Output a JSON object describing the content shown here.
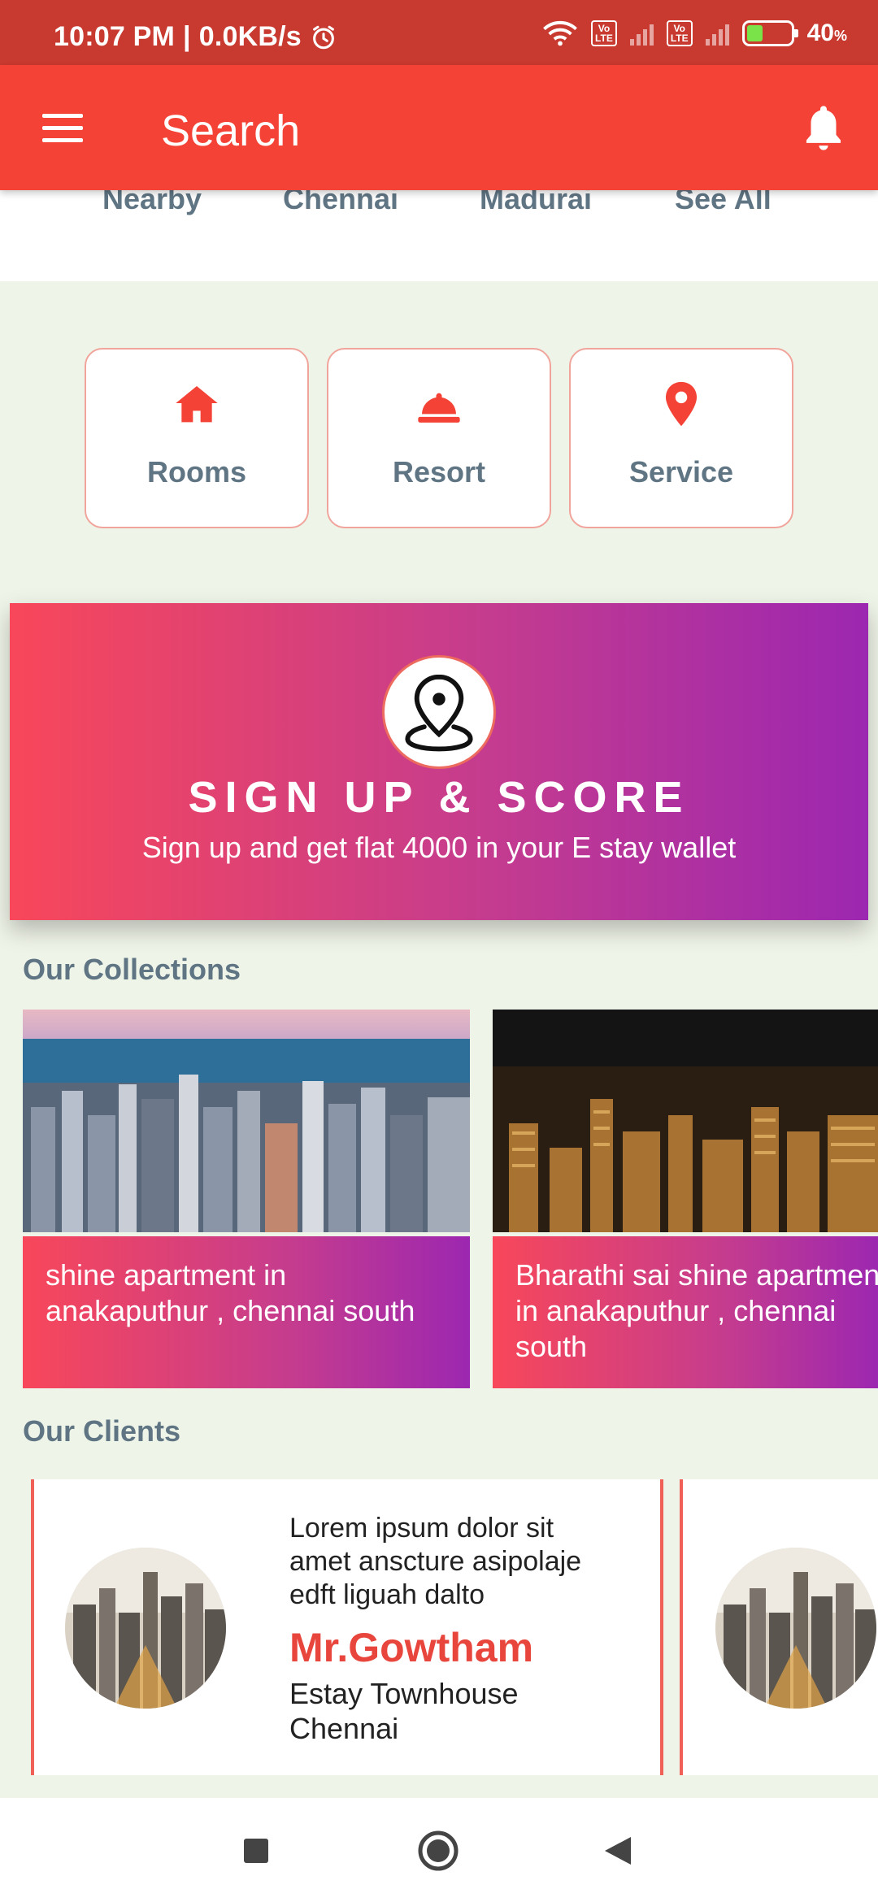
{
  "status_bar": {
    "time": "10:07 PM",
    "net_speed": "0.0KB/s",
    "battery": "40",
    "battery_unit": "%"
  },
  "app_bar": {
    "title": "Search",
    "menu_icon": "menu-icon",
    "notification_icon": "bell-icon"
  },
  "city_tabs": [
    "Nearby",
    "Chennai",
    "Madurai",
    "See All"
  ],
  "categories": [
    {
      "label": "Rooms",
      "icon": "home-icon"
    },
    {
      "label": "Resort",
      "icon": "service-bell-icon"
    },
    {
      "label": "Service",
      "icon": "map-pin-icon"
    }
  ],
  "banner": {
    "title": "SIGN UP & SCORE",
    "subtitle": "Sign up and get flat 4000 in your E stay wallet",
    "icon": "location-pin-icon"
  },
  "collections": {
    "title": "Our Collections",
    "items": [
      {
        "caption_line1": "shine apartment in",
        "caption_line2": "anakaputhur , chennai south",
        "caption_line3": ""
      },
      {
        "caption_line1": "Bharathi sai shine apartment",
        "caption_line2": "in anakaputhur , chennai",
        "caption_line3": "south"
      }
    ]
  },
  "clients": {
    "title": "Our Clients",
    "items": [
      {
        "quote_line1": "Lorem ipsum dolor sit",
        "quote_line2": "amet anscture asipolaje",
        "quote_line3": "edft liguah dalto",
        "name": "Mr.Gowtham",
        "company_line1": "Estay Townhouse",
        "company_line2": "Chennai"
      }
    ]
  },
  "colors": {
    "primary": "#f44336",
    "status_bar": "#c8392f",
    "gradient_start": "#f8475a",
    "gradient_end": "#9c27b0",
    "text_muted": "#5f7584",
    "page_bg": "#eff4e8"
  }
}
